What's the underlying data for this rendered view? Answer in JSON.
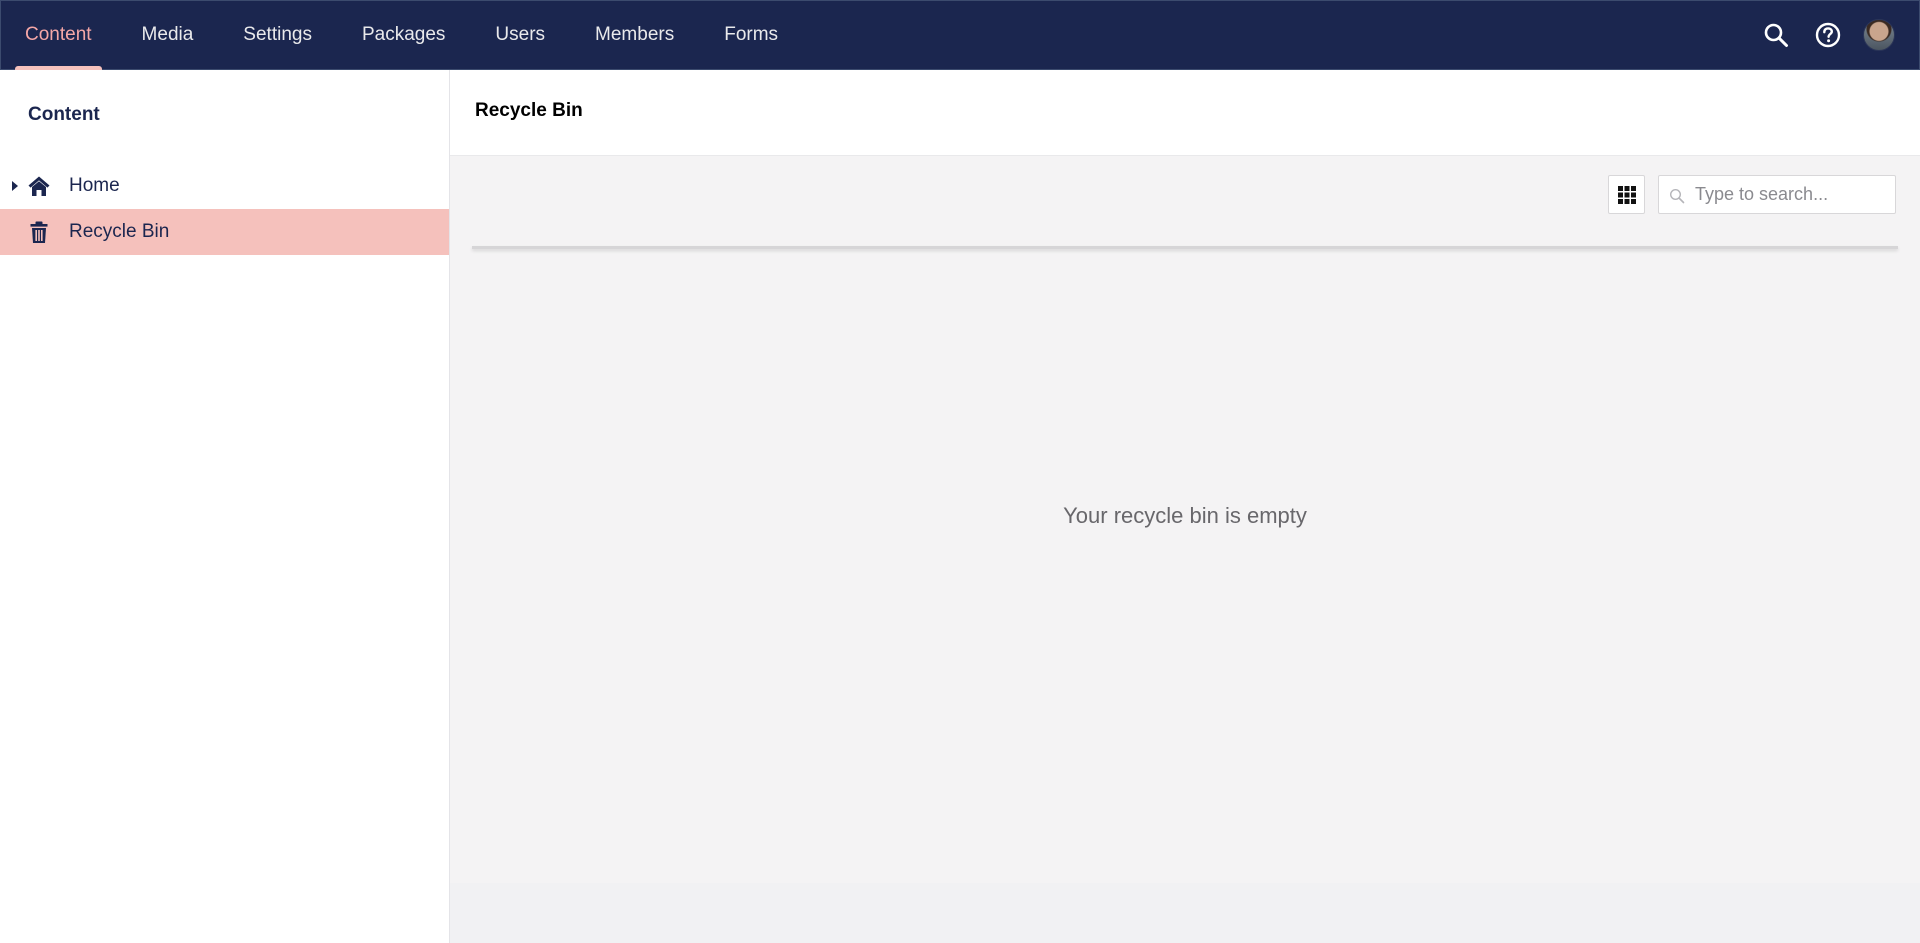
{
  "nav": {
    "items": [
      {
        "label": "Content",
        "active": true
      },
      {
        "label": "Media"
      },
      {
        "label": "Settings"
      },
      {
        "label": "Packages"
      },
      {
        "label": "Users"
      },
      {
        "label": "Members"
      },
      {
        "label": "Forms"
      }
    ],
    "actions": [
      "search-icon",
      "help-icon",
      "avatar"
    ]
  },
  "sidebar": {
    "title": "Content",
    "items": [
      {
        "label": "Home",
        "icon": "home-icon",
        "expandable": true
      },
      {
        "label": "Recycle Bin",
        "icon": "trash-icon",
        "selected": true
      }
    ]
  },
  "main": {
    "title": "Recycle Bin",
    "search": {
      "placeholder": "Type to search...",
      "value": ""
    },
    "view_toggle_icon": "grid-icon",
    "empty_message": "Your recycle bin is empty"
  },
  "colors": {
    "nav_bg": "#1b264f",
    "accent": "#f5c1bc",
    "active_nav_text": "#f5a7a7",
    "main_bg": "#f4f3f4"
  }
}
